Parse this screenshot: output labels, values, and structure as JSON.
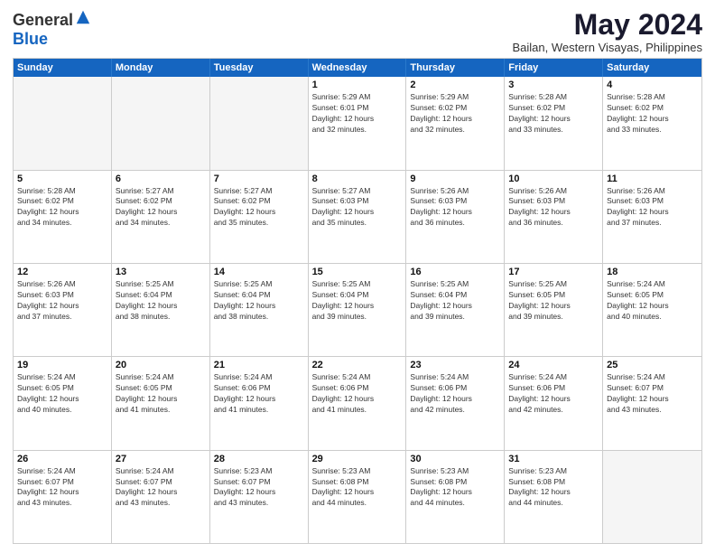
{
  "header": {
    "logo_general": "General",
    "logo_blue": "Blue",
    "title": "May 2024",
    "subtitle": "Bailan, Western Visayas, Philippines"
  },
  "days_of_week": [
    "Sunday",
    "Monday",
    "Tuesday",
    "Wednesday",
    "Thursday",
    "Friday",
    "Saturday"
  ],
  "weeks": [
    [
      {
        "day": "",
        "empty": true,
        "lines": []
      },
      {
        "day": "",
        "empty": true,
        "lines": []
      },
      {
        "day": "",
        "empty": true,
        "lines": []
      },
      {
        "day": "1",
        "empty": false,
        "lines": [
          "Sunrise: 5:29 AM",
          "Sunset: 6:01 PM",
          "Daylight: 12 hours",
          "and 32 minutes."
        ]
      },
      {
        "day": "2",
        "empty": false,
        "lines": [
          "Sunrise: 5:29 AM",
          "Sunset: 6:02 PM",
          "Daylight: 12 hours",
          "and 32 minutes."
        ]
      },
      {
        "day": "3",
        "empty": false,
        "lines": [
          "Sunrise: 5:28 AM",
          "Sunset: 6:02 PM",
          "Daylight: 12 hours",
          "and 33 minutes."
        ]
      },
      {
        "day": "4",
        "empty": false,
        "lines": [
          "Sunrise: 5:28 AM",
          "Sunset: 6:02 PM",
          "Daylight: 12 hours",
          "and 33 minutes."
        ]
      }
    ],
    [
      {
        "day": "5",
        "empty": false,
        "lines": [
          "Sunrise: 5:28 AM",
          "Sunset: 6:02 PM",
          "Daylight: 12 hours",
          "and 34 minutes."
        ]
      },
      {
        "day": "6",
        "empty": false,
        "lines": [
          "Sunrise: 5:27 AM",
          "Sunset: 6:02 PM",
          "Daylight: 12 hours",
          "and 34 minutes."
        ]
      },
      {
        "day": "7",
        "empty": false,
        "lines": [
          "Sunrise: 5:27 AM",
          "Sunset: 6:02 PM",
          "Daylight: 12 hours",
          "and 35 minutes."
        ]
      },
      {
        "day": "8",
        "empty": false,
        "lines": [
          "Sunrise: 5:27 AM",
          "Sunset: 6:03 PM",
          "Daylight: 12 hours",
          "and 35 minutes."
        ]
      },
      {
        "day": "9",
        "empty": false,
        "lines": [
          "Sunrise: 5:26 AM",
          "Sunset: 6:03 PM",
          "Daylight: 12 hours",
          "and 36 minutes."
        ]
      },
      {
        "day": "10",
        "empty": false,
        "lines": [
          "Sunrise: 5:26 AM",
          "Sunset: 6:03 PM",
          "Daylight: 12 hours",
          "and 36 minutes."
        ]
      },
      {
        "day": "11",
        "empty": false,
        "lines": [
          "Sunrise: 5:26 AM",
          "Sunset: 6:03 PM",
          "Daylight: 12 hours",
          "and 37 minutes."
        ]
      }
    ],
    [
      {
        "day": "12",
        "empty": false,
        "lines": [
          "Sunrise: 5:26 AM",
          "Sunset: 6:03 PM",
          "Daylight: 12 hours",
          "and 37 minutes."
        ]
      },
      {
        "day": "13",
        "empty": false,
        "lines": [
          "Sunrise: 5:25 AM",
          "Sunset: 6:04 PM",
          "Daylight: 12 hours",
          "and 38 minutes."
        ]
      },
      {
        "day": "14",
        "empty": false,
        "lines": [
          "Sunrise: 5:25 AM",
          "Sunset: 6:04 PM",
          "Daylight: 12 hours",
          "and 38 minutes."
        ]
      },
      {
        "day": "15",
        "empty": false,
        "lines": [
          "Sunrise: 5:25 AM",
          "Sunset: 6:04 PM",
          "Daylight: 12 hours",
          "and 39 minutes."
        ]
      },
      {
        "day": "16",
        "empty": false,
        "lines": [
          "Sunrise: 5:25 AM",
          "Sunset: 6:04 PM",
          "Daylight: 12 hours",
          "and 39 minutes."
        ]
      },
      {
        "day": "17",
        "empty": false,
        "lines": [
          "Sunrise: 5:25 AM",
          "Sunset: 6:05 PM",
          "Daylight: 12 hours",
          "and 39 minutes."
        ]
      },
      {
        "day": "18",
        "empty": false,
        "lines": [
          "Sunrise: 5:24 AM",
          "Sunset: 6:05 PM",
          "Daylight: 12 hours",
          "and 40 minutes."
        ]
      }
    ],
    [
      {
        "day": "19",
        "empty": false,
        "lines": [
          "Sunrise: 5:24 AM",
          "Sunset: 6:05 PM",
          "Daylight: 12 hours",
          "and 40 minutes."
        ]
      },
      {
        "day": "20",
        "empty": false,
        "lines": [
          "Sunrise: 5:24 AM",
          "Sunset: 6:05 PM",
          "Daylight: 12 hours",
          "and 41 minutes."
        ]
      },
      {
        "day": "21",
        "empty": false,
        "lines": [
          "Sunrise: 5:24 AM",
          "Sunset: 6:06 PM",
          "Daylight: 12 hours",
          "and 41 minutes."
        ]
      },
      {
        "day": "22",
        "empty": false,
        "lines": [
          "Sunrise: 5:24 AM",
          "Sunset: 6:06 PM",
          "Daylight: 12 hours",
          "and 41 minutes."
        ]
      },
      {
        "day": "23",
        "empty": false,
        "lines": [
          "Sunrise: 5:24 AM",
          "Sunset: 6:06 PM",
          "Daylight: 12 hours",
          "and 42 minutes."
        ]
      },
      {
        "day": "24",
        "empty": false,
        "lines": [
          "Sunrise: 5:24 AM",
          "Sunset: 6:06 PM",
          "Daylight: 12 hours",
          "and 42 minutes."
        ]
      },
      {
        "day": "25",
        "empty": false,
        "lines": [
          "Sunrise: 5:24 AM",
          "Sunset: 6:07 PM",
          "Daylight: 12 hours",
          "and 43 minutes."
        ]
      }
    ],
    [
      {
        "day": "26",
        "empty": false,
        "lines": [
          "Sunrise: 5:24 AM",
          "Sunset: 6:07 PM",
          "Daylight: 12 hours",
          "and 43 minutes."
        ]
      },
      {
        "day": "27",
        "empty": false,
        "lines": [
          "Sunrise: 5:24 AM",
          "Sunset: 6:07 PM",
          "Daylight: 12 hours",
          "and 43 minutes."
        ]
      },
      {
        "day": "28",
        "empty": false,
        "lines": [
          "Sunrise: 5:23 AM",
          "Sunset: 6:07 PM",
          "Daylight: 12 hours",
          "and 43 minutes."
        ]
      },
      {
        "day": "29",
        "empty": false,
        "lines": [
          "Sunrise: 5:23 AM",
          "Sunset: 6:08 PM",
          "Daylight: 12 hours",
          "and 44 minutes."
        ]
      },
      {
        "day": "30",
        "empty": false,
        "lines": [
          "Sunrise: 5:23 AM",
          "Sunset: 6:08 PM",
          "Daylight: 12 hours",
          "and 44 minutes."
        ]
      },
      {
        "day": "31",
        "empty": false,
        "lines": [
          "Sunrise: 5:23 AM",
          "Sunset: 6:08 PM",
          "Daylight: 12 hours",
          "and 44 minutes."
        ]
      },
      {
        "day": "",
        "empty": true,
        "lines": []
      }
    ]
  ]
}
